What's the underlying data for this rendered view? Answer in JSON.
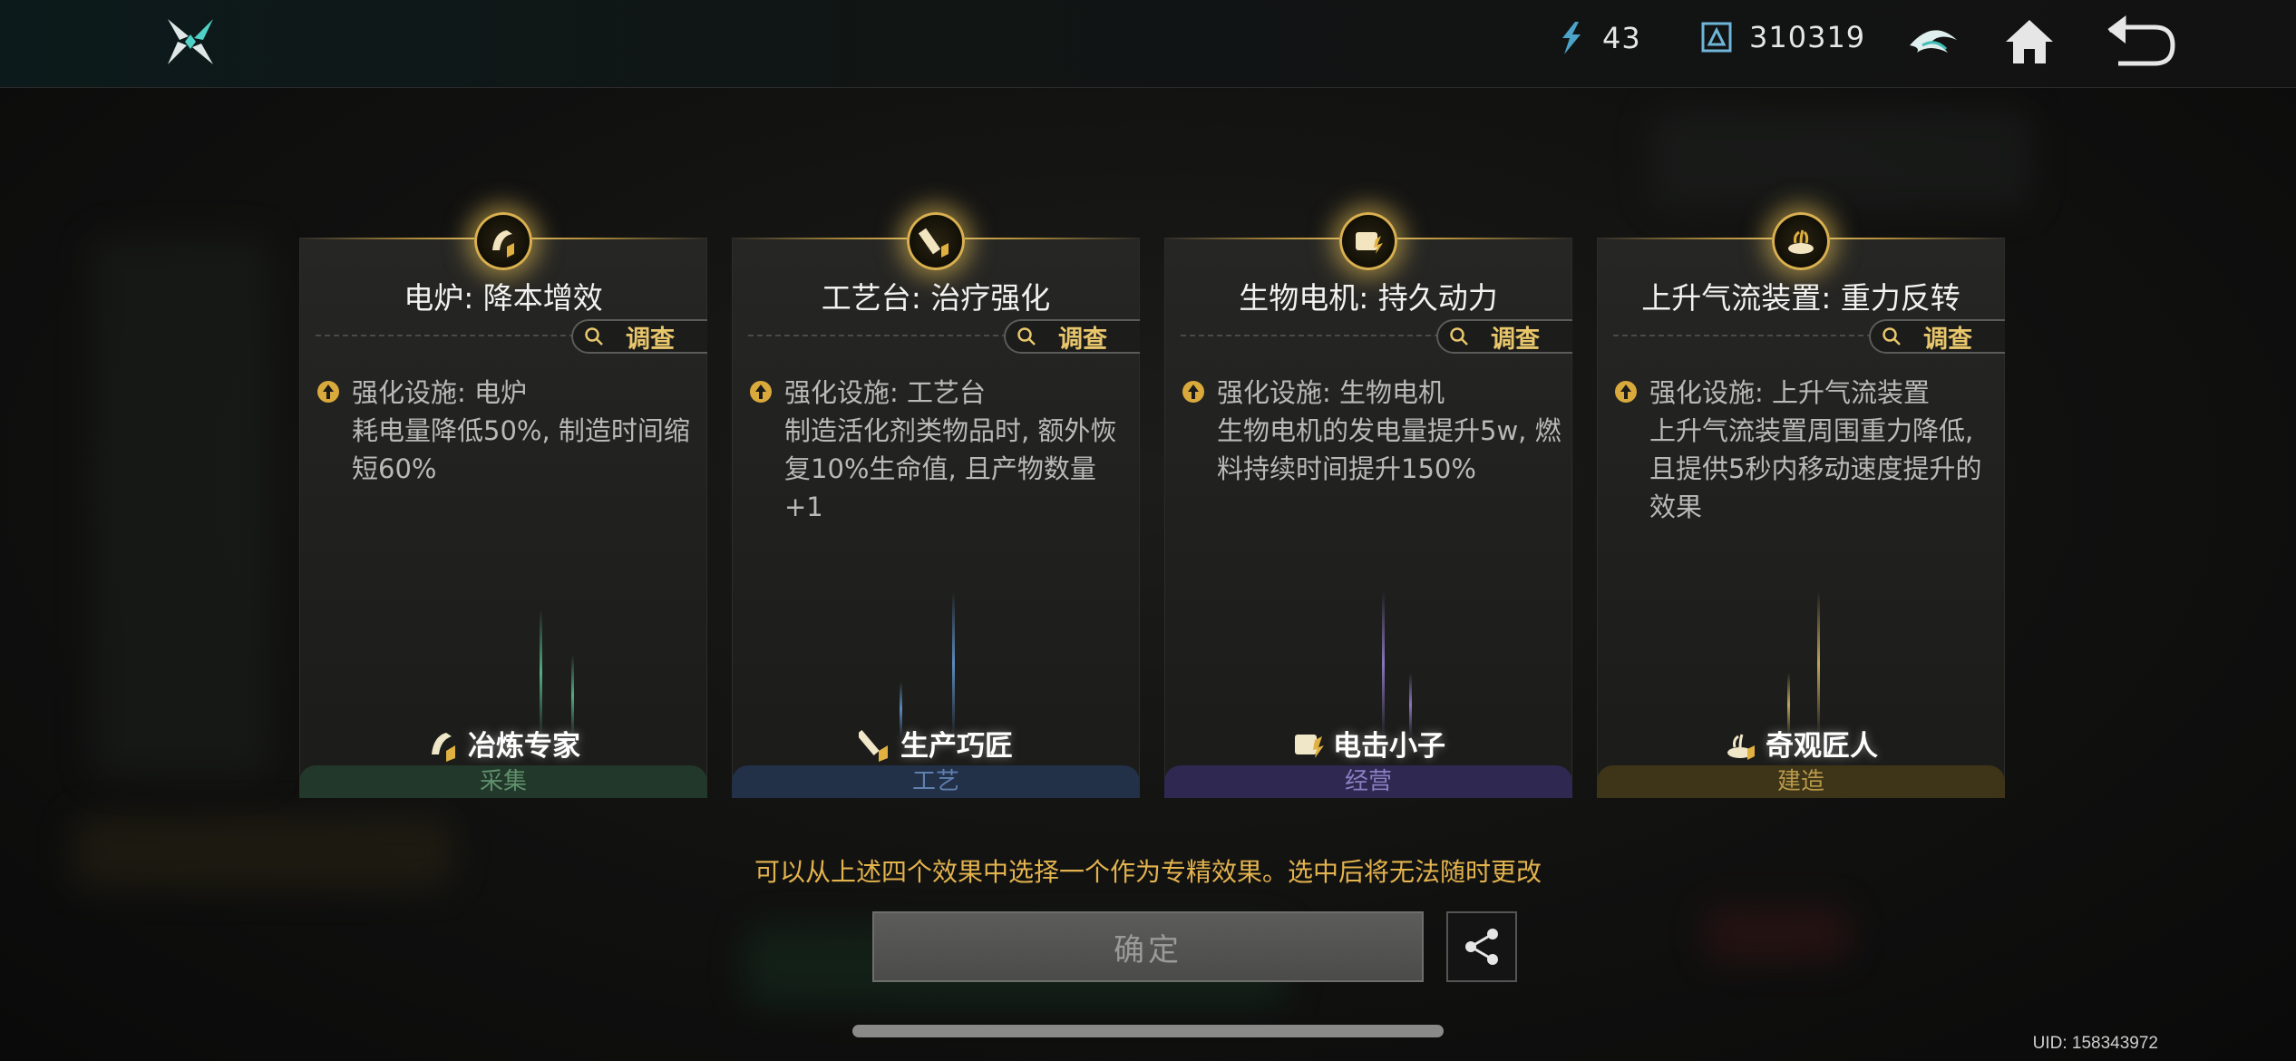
{
  "topbar": {
    "currency1": "43",
    "currency2": "310319"
  },
  "cards": [
    {
      "title": "电炉: 降本增效",
      "inspect_label": "调查",
      "effect_title": "强化设施: 电炉",
      "effect_body": "耗电量降低50%, 制造时间缩短60%",
      "role": "冶炼专家",
      "category": "采集"
    },
    {
      "title": "工艺台: 治疗强化",
      "inspect_label": "调查",
      "effect_title": "强化设施: 工艺台",
      "effect_body": "制造活化剂类物品时, 额外恢复10%生命值, 且产物数量+1",
      "role": "生产巧匠",
      "category": "工艺"
    },
    {
      "title": "生物电机: 持久动力",
      "inspect_label": "调查",
      "effect_title": "强化设施: 生物电机",
      "effect_body": "生物电机的发电量提升5w, 燃料持续时间提升150%",
      "role": "电击小子",
      "category": "经营"
    },
    {
      "title": "上升气流装置: 重力反转",
      "inspect_label": "调查",
      "effect_title": "强化设施: 上升气流装置",
      "effect_body": "上升气流装置周围重力降低, 且提供5秒内移动速度提升的效果",
      "role": "奇观匠人",
      "category": "建造"
    }
  ],
  "hint": "可以从上述四个效果中选择一个作为专精效果。选中后将无法随时更改",
  "confirm_label": "确定",
  "uid": "UID: 158343972",
  "colors": {
    "gold": "#e3b34e",
    "cat_gather": "#2e4a37",
    "cat_craft": "#2a3a55",
    "cat_manage": "#3b3460",
    "cat_build": "#4a3f1e"
  }
}
